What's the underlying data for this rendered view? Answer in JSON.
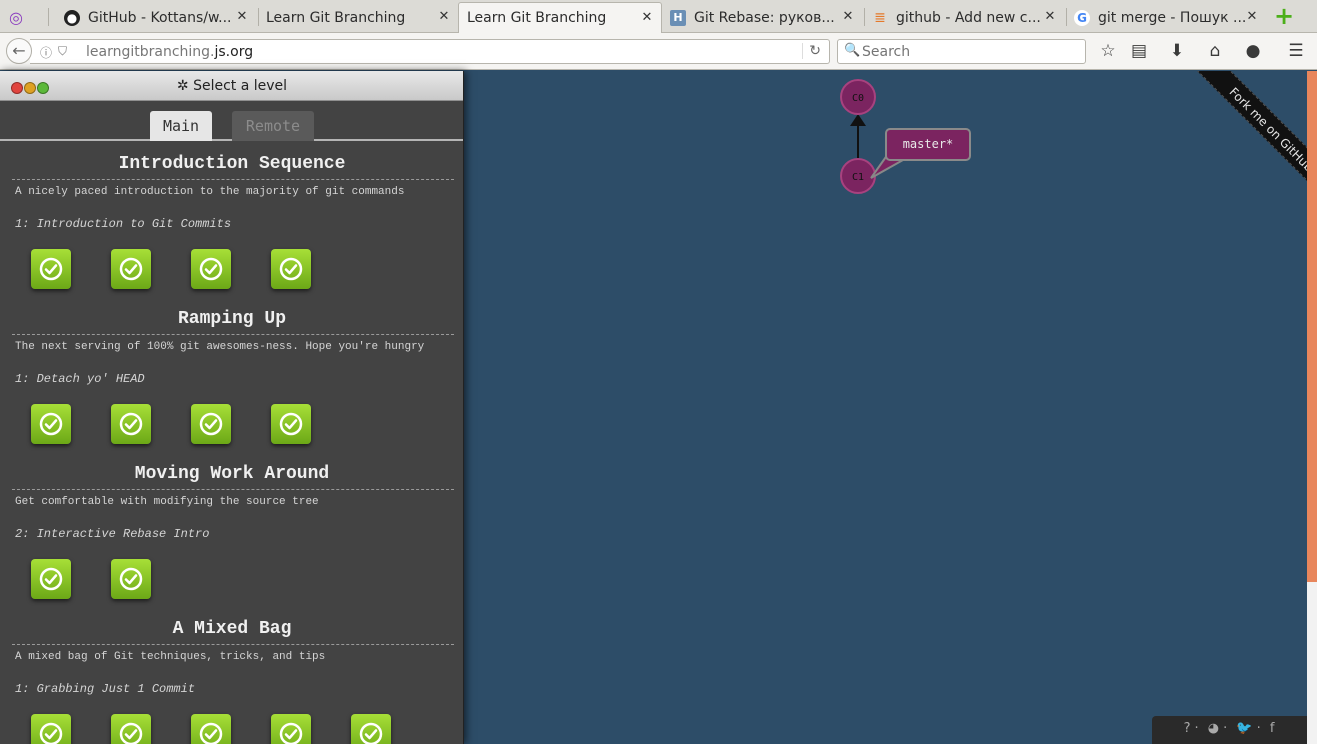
{
  "browser": {
    "tabs": [
      {
        "title": "",
        "icon": "mask-icon"
      },
      {
        "title": "GitHub - Kottans/w...",
        "icon": "github-icon"
      },
      {
        "title": "Learn Git Branching",
        "icon": ""
      },
      {
        "title": "Learn Git Branching",
        "icon": ""
      },
      {
        "title": "Git Rebase: руков...",
        "icon": "h-icon"
      },
      {
        "title": "github - Add new c...",
        "icon": "stackoverflow-icon"
      },
      {
        "title": "git merge - Пошук ...",
        "icon": "google-icon"
      }
    ],
    "url_prefix": "learngitbranching.",
    "url_domain": "js.org",
    "search_placeholder": "Search"
  },
  "panel": {
    "title": "✲ Select a level",
    "tabs": [
      "Main",
      "Remote"
    ],
    "sequences": [
      {
        "title": "Introduction Sequence",
        "desc": "A nicely paced introduction to the majority of git commands",
        "current": "1: Introduction to Git Commits",
        "levels": 4
      },
      {
        "title": "Ramping Up",
        "desc": "The next serving of 100% git awesomes-ness. Hope you're hungry",
        "current": "1: Detach yo' HEAD",
        "levels": 4
      },
      {
        "title": "Moving Work Around",
        "desc": "Get comfortable with modifying the source tree",
        "current": "2: Interactive Rebase Intro",
        "levels": 2
      },
      {
        "title": "A Mixed Bag",
        "desc": "A mixed bag of Git techniques, tricks, and tips",
        "current": "1: Grabbing Just 1 Commit",
        "levels": 5
      }
    ]
  },
  "vis": {
    "commits": [
      "C0",
      "C1"
    ],
    "branch": "master*",
    "ribbon": "Fork me on GitHub",
    "footer_icons": [
      "help-icon",
      "globe-icon",
      "twitter-icon",
      "facebook-icon"
    ],
    "footer_glyphs": [
      "?",
      "◕",
      "🐦",
      "f"
    ]
  }
}
